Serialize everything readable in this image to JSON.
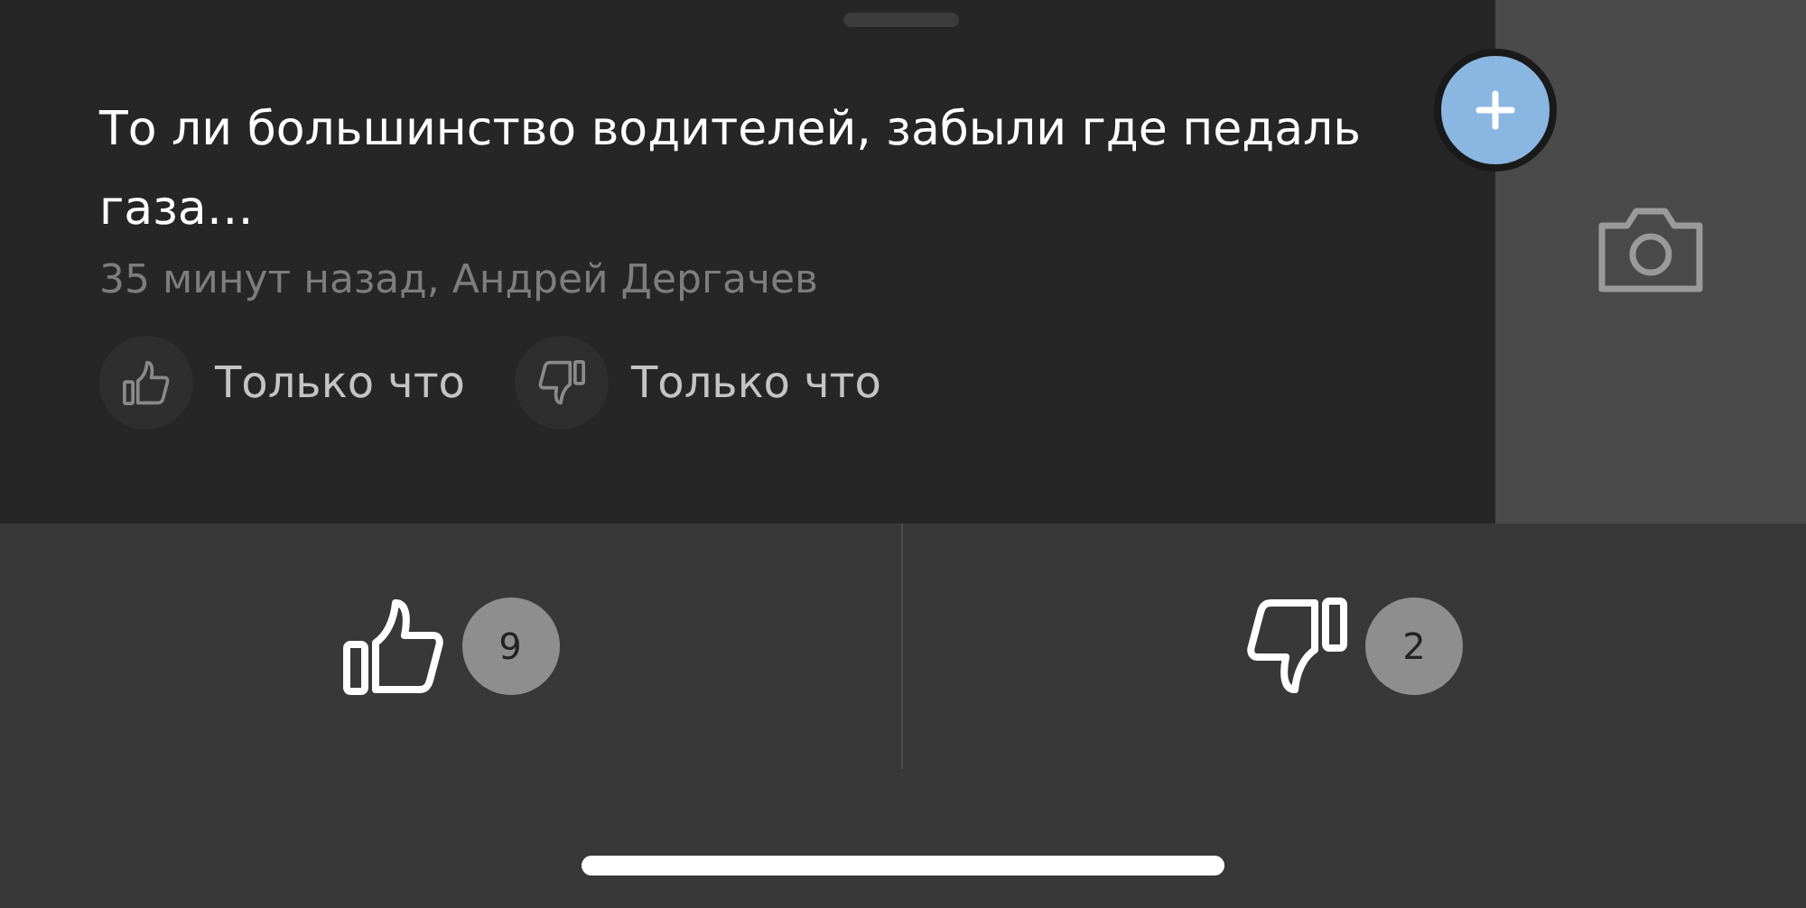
{
  "post": {
    "title": "То ли большинство водителей, забыли где педаль газа…",
    "meta": "35 минут назад, Андрей Дергачев",
    "reactions": [
      {
        "kind": "like",
        "label": "Только что"
      },
      {
        "kind": "dislike",
        "label": "Только что"
      }
    ]
  },
  "votes": [
    {
      "kind": "like",
      "count": "9"
    },
    {
      "kind": "dislike",
      "count": "2"
    }
  ]
}
